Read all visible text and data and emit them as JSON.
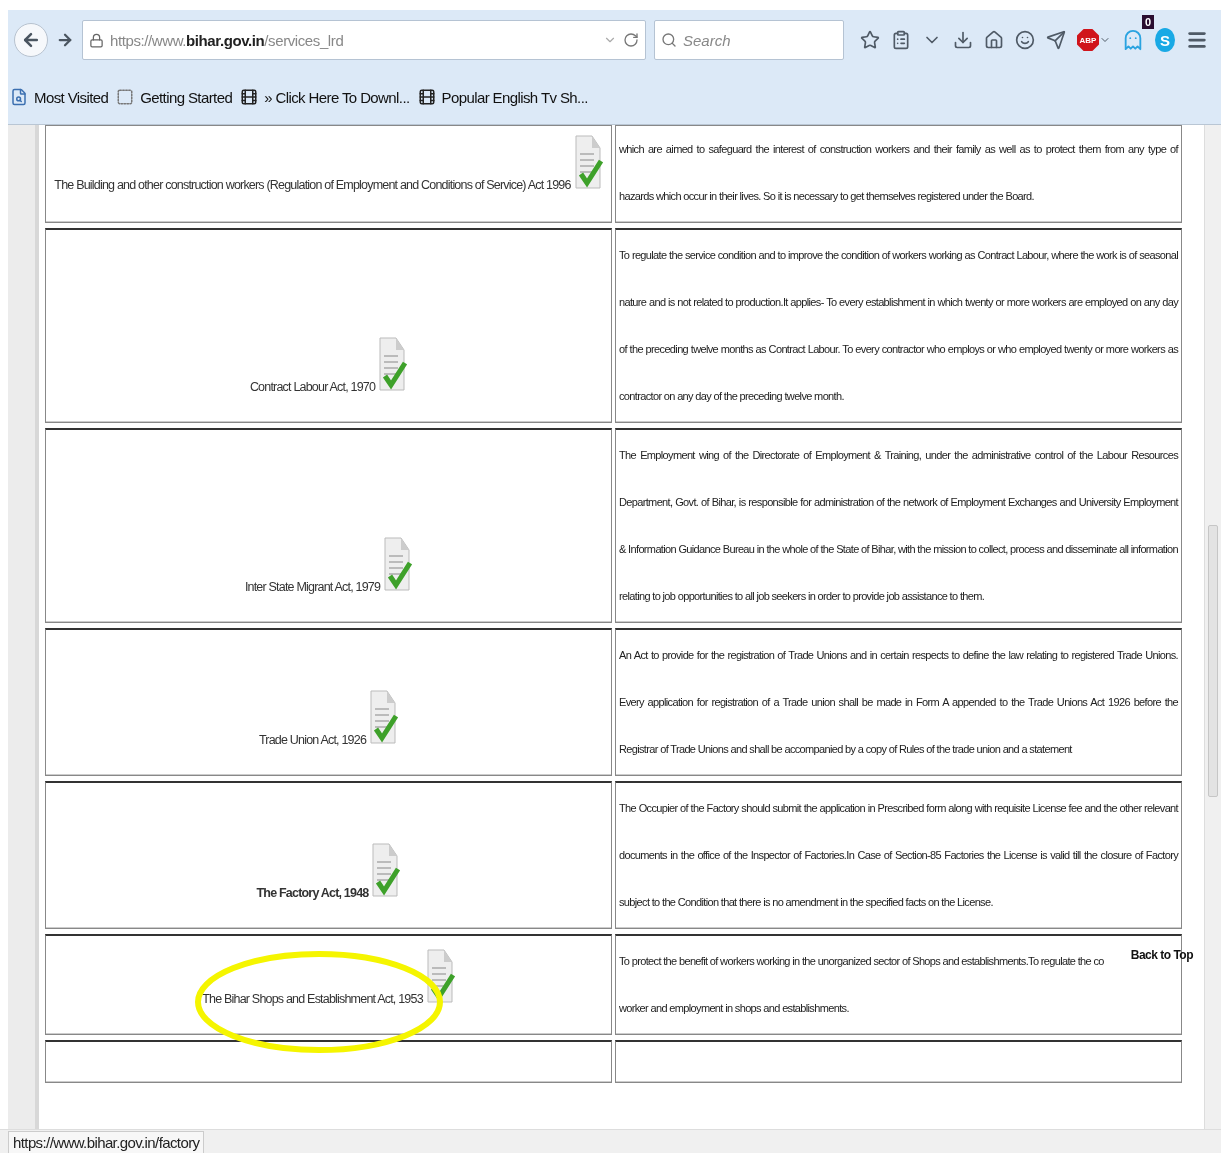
{
  "browser": {
    "url_host": "https://www.",
    "url_domain": "bihar.gov.in",
    "url_path": "/services_lrd",
    "search_placeholder": "Search",
    "adblock_label": "ABP",
    "ghost_badge": "0",
    "skype_letter": "S"
  },
  "bookmarks": [
    {
      "label": "Most Visited",
      "kind": "page"
    },
    {
      "label": "Getting Started",
      "kind": "blank"
    },
    {
      "label": "» Click Here To Downl...",
      "kind": "reel"
    },
    {
      "label": "Popular English Tv Sh...",
      "kind": "reel"
    }
  ],
  "rows": [
    {
      "act": "The Building and other construction workers (Regulation of Employment and Conditions of Service) Act 1996",
      "bold": false,
      "highlighted": false,
      "description": "which are aimed to safeguard the interest of construction workers and their family as well as to protect them from any type of hazards which occur in their lives. So it is necessary to get themselves registered under the Board."
    },
    {
      "act": "Contract Labour Act, 1970",
      "bold": false,
      "highlighted": false,
      "description": "To regulate the service condition and to improve the condition of workers working as Contract Labour, where the work is of seasonal nature and is not related to production.It applies- To every establishment in which twenty or more workers are employed on any day of the preceding twelve months as Contract Labour. To every contractor who employs or who employed twenty or more workers as contractor on any day of the preceding twelve month."
    },
    {
      "act": "Inter State Migrant Act, 1979",
      "bold": false,
      "highlighted": false,
      "description": "The Employment wing of the Directorate of Employment & Training, under the administrative control of the Labour Resources Department, Govt. of Bihar, is responsible for administration of the network of Employment Exchanges and University Employment & Information Guidance Bureau in the whole of the State of Bihar, with the mission to collect, process and disseminate all information relating to job opportunities to all job seekers in order to provide job assistance to them."
    },
    {
      "act": "Trade Union Act, 1926",
      "bold": false,
      "highlighted": false,
      "description": "An Act to provide for the registration of Trade Unions and in certain respects to define the law relating to registered Trade Unions. Every application for registration of a Trade union shall be made in Form A appended to the Trade Unions Act 1926 before the Registrar of Trade Unions and shall be accompanied by a copy of Rules of the trade union and a statement"
    },
    {
      "act": "The Factory Act, 1948",
      "bold": true,
      "highlighted": false,
      "description": "The Occupier of the Factory should submit the application in Prescribed form along with requisite License fee and the other relevant documents in the office of the Inspector of Factories.In Case of Section-85 Factories the License is valid till the closure of Factory subject to the Condition that there is no amendment in the specified facts on the License."
    },
    {
      "act": "The Bihar Shops and Establishment Act, 1953",
      "bold": false,
      "highlighted": true,
      "description": "To protect the benefit of workers working in the unorganized sector of Shops and establishments.To regulate the co",
      "description_end": "worker and employment in shops and establishments."
    }
  ],
  "back_to_top": "Back to Top",
  "status_link": "https://www.bihar.gov.in/factory"
}
